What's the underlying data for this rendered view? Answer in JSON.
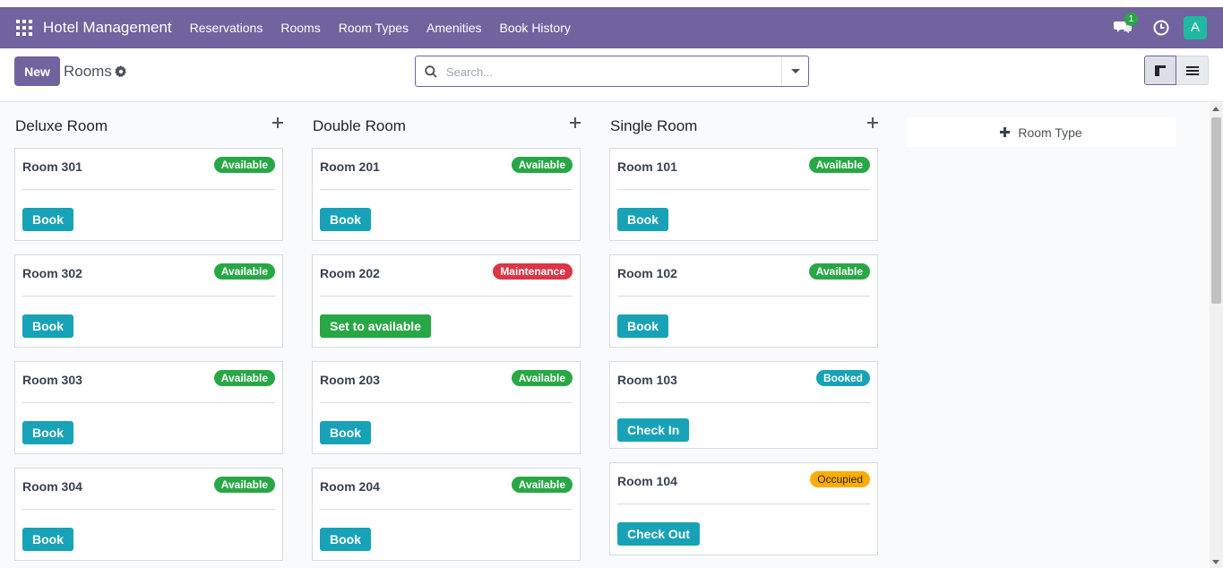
{
  "app": {
    "name": "Hotel Management",
    "menu": [
      "Reservations",
      "Rooms",
      "Room Types",
      "Amenities",
      "Book History"
    ],
    "chat_count": "1",
    "avatar_letter": "A"
  },
  "control": {
    "new_label": "New",
    "title": "Rooms",
    "search_placeholder": "Search..."
  },
  "add_column_label": "Room Type",
  "colors": {
    "brand": "#71639e",
    "available": "#28a745",
    "maintenance": "#dc3545",
    "booked": "#17a2b8",
    "occupied": "#ffac00"
  },
  "columns": [
    {
      "title": "Deluxe Room",
      "cards": [
        {
          "name": "Room 301",
          "status": "Available",
          "button": "Book"
        },
        {
          "name": "Room 302",
          "status": "Available",
          "button": "Book"
        },
        {
          "name": "Room 303",
          "status": "Available",
          "button": "Book"
        },
        {
          "name": "Room 304",
          "status": "Available",
          "button": "Book"
        }
      ]
    },
    {
      "title": "Double Room",
      "cards": [
        {
          "name": "Room 201",
          "status": "Available",
          "button": "Book"
        },
        {
          "name": "Room 202",
          "status": "Maintenance",
          "button": "Set to available"
        },
        {
          "name": "Room 203",
          "status": "Available",
          "button": "Book"
        },
        {
          "name": "Room 204",
          "status": "Available",
          "button": "Book"
        }
      ]
    },
    {
      "title": "Single Room",
      "cards": [
        {
          "name": "Room 101",
          "status": "Available",
          "button": "Book"
        },
        {
          "name": "Room 102",
          "status": "Available",
          "button": "Book"
        },
        {
          "name": "Room 103",
          "status": "Booked",
          "button": "Check In"
        },
        {
          "name": "Room 104",
          "status": "Occupied",
          "button": "Check Out"
        }
      ]
    }
  ]
}
